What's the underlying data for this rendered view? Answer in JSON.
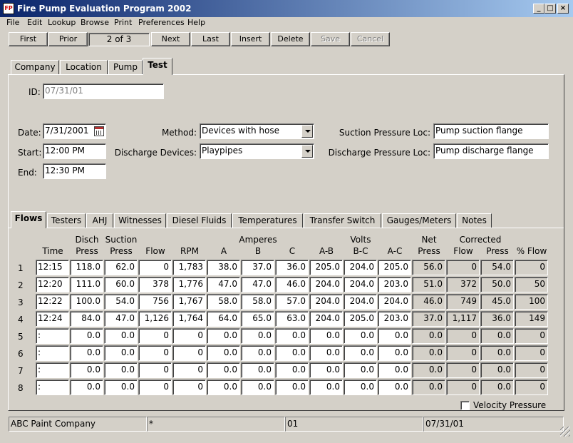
{
  "window": {
    "title": "Fire Pump Evaluation Program 2002",
    "minimize": "_",
    "maximize": "□",
    "close": "×"
  },
  "menu": [
    "File",
    "Edit",
    "Lookup",
    "Browse",
    "Print",
    "Preferences",
    "Help"
  ],
  "toolbar": {
    "first": "First",
    "prior": "Prior",
    "record_position": "2 of 3",
    "next": "Next",
    "last": "Last",
    "insert": "Insert",
    "delete": "Delete",
    "save": "Save",
    "cancel": "Cancel"
  },
  "main_tabs": [
    "Company",
    "Location",
    "Pump",
    "Test"
  ],
  "test": {
    "id_label": "ID:",
    "id_value": "07/31/01",
    "date_label": "Date:",
    "date_value": "7/31/2001",
    "start_label": "Start:",
    "start_value": "12:00 PM",
    "end_label": "End:",
    "end_value": "12:30 PM",
    "method_label": "Method:",
    "method_value": "Devices with hose",
    "discharge_devices_label": "Discharge Devices:",
    "discharge_devices_value": "Playpipes",
    "suction_loc_label": "Suction Pressure Loc:",
    "suction_loc_value": "Pump suction flange",
    "discharge_loc_label": "Discharge Pressure Loc:",
    "discharge_loc_value": "Pump discharge flange"
  },
  "sub_tabs": [
    "Flows",
    "Testers",
    "AHJ",
    "Witnesses",
    "Diesel Fluids",
    "Temperatures",
    "Transfer Switch",
    "Gauges/Meters",
    "Notes"
  ],
  "grid": {
    "group_headers": {
      "disch": "Disch",
      "suction": "Suction",
      "amperes": "Amperes",
      "volts": "Volts",
      "net": "Net",
      "corrected": "Corrected"
    },
    "columns": [
      "Time",
      "Press",
      "Press",
      "Flow",
      "RPM",
      "A",
      "B",
      "C",
      "A-B",
      "B-C",
      "A-C",
      "Press",
      "Flow",
      "Press",
      "% Flow"
    ],
    "rows": [
      {
        "n": "1",
        "cells": [
          "12:15",
          "118.0",
          "62.0",
          "0",
          "1,783",
          "38.0",
          "37.0",
          "36.0",
          "205.0",
          "204.0",
          "205.0",
          "56.0",
          "0",
          "54.0",
          "0"
        ]
      },
      {
        "n": "2",
        "cells": [
          "12:20",
          "111.0",
          "60.0",
          "378",
          "1,776",
          "47.0",
          "47.0",
          "46.0",
          "204.0",
          "204.0",
          "203.0",
          "51.0",
          "372",
          "50.0",
          "50"
        ]
      },
      {
        "n": "3",
        "cells": [
          "12:22",
          "100.0",
          "54.0",
          "756",
          "1,767",
          "58.0",
          "58.0",
          "57.0",
          "204.0",
          "204.0",
          "204.0",
          "46.0",
          "749",
          "45.0",
          "100"
        ]
      },
      {
        "n": "4",
        "cells": [
          "12:24",
          "84.0",
          "47.0",
          "1,126",
          "1,764",
          "64.0",
          "65.0",
          "63.0",
          "204.0",
          "205.0",
          "203.0",
          "37.0",
          "1,117",
          "36.0",
          "149"
        ]
      },
      {
        "n": "5",
        "cells": [
          ":",
          "0.0",
          "0.0",
          "0",
          "0",
          "0.0",
          "0.0",
          "0.0",
          "0.0",
          "0.0",
          "0.0",
          "0.0",
          "0",
          "0.0",
          "0"
        ]
      },
      {
        "n": "6",
        "cells": [
          ":",
          "0.0",
          "0.0",
          "0",
          "0",
          "0.0",
          "0.0",
          "0.0",
          "0.0",
          "0.0",
          "0.0",
          "0.0",
          "0",
          "0.0",
          "0"
        ]
      },
      {
        "n": "7",
        "cells": [
          ":",
          "0.0",
          "0.0",
          "0",
          "0",
          "0.0",
          "0.0",
          "0.0",
          "0.0",
          "0.0",
          "0.0",
          "0.0",
          "0",
          "0.0",
          "0"
        ]
      },
      {
        "n": "8",
        "cells": [
          ":",
          "0.0",
          "0.0",
          "0",
          "0",
          "0.0",
          "0.0",
          "0.0",
          "0.0",
          "0.0",
          "0.0",
          "0.0",
          "0",
          "0.0",
          "0"
        ]
      }
    ],
    "velocity_pressure_label": "Velocity Pressure"
  },
  "status": {
    "company": "ABC Paint Company",
    "modified": "*",
    "location": "01",
    "test_id": "07/31/01"
  }
}
